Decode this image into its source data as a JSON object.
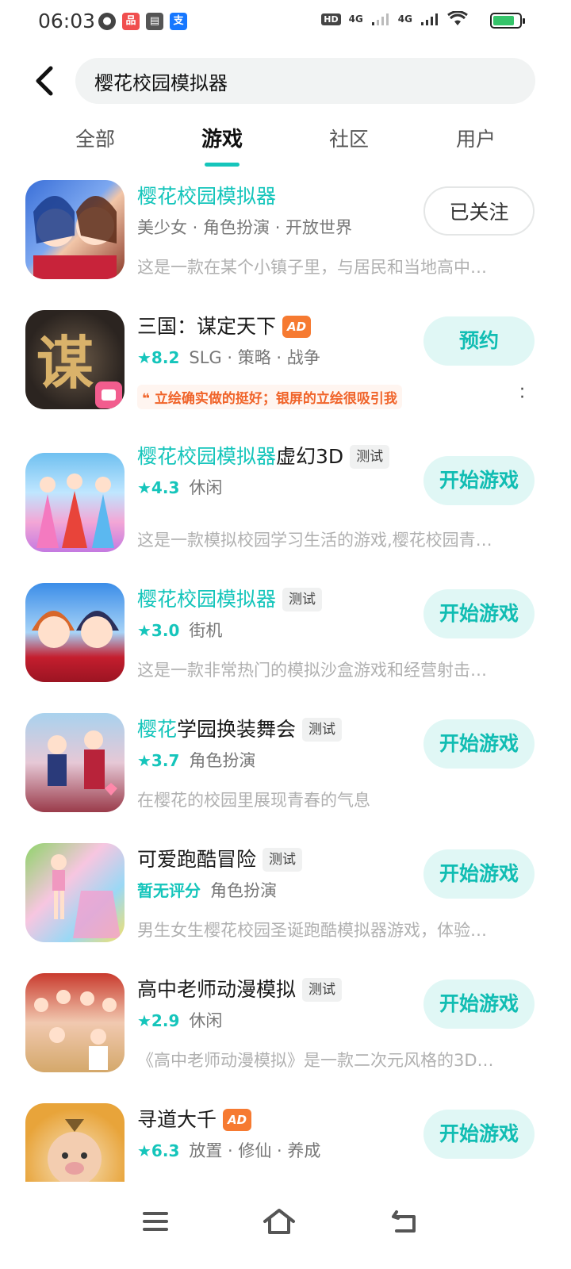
{
  "status_bar": {
    "time": "06:03",
    "network_1": "4G",
    "network_2": "4G",
    "hd": "HD",
    "battery_level": 0.8
  },
  "search": {
    "query": "樱花校园模拟器"
  },
  "tabs": [
    {
      "label": "全部",
      "active": false
    },
    {
      "label": "游戏",
      "active": true
    },
    {
      "label": "社区",
      "active": false
    },
    {
      "label": "用户",
      "active": false
    }
  ],
  "results": [
    {
      "title_hl": "樱花校园模拟器",
      "title_rest": "",
      "tags": "美少女 · 角色扮演 · 开放世界",
      "rating": "",
      "desc": "这是一款在某个小镇子里，与居民和当地高中…",
      "action": "已关注",
      "icon": "game-icon-sakura-school-girls"
    },
    {
      "title_hl": "",
      "title_rest": "三国：谋定天下",
      "ad": "AD",
      "rating": "★8.2",
      "tags": "SLG · 策略 · 战争",
      "quote": "立绘确实做的挺好；银屏的立绘很吸引我",
      "action": "预约",
      "icon": "game-icon-three-kingdoms"
    },
    {
      "title_hl": "樱花校园模拟器",
      "title_rest": "虚幻3D",
      "test": "测试",
      "rating": "★4.3",
      "tags": "休闲",
      "desc": "这是一款模拟校园学习生活的游戏,樱花校园青…",
      "action": "开始游戏",
      "icon": "game-icon-princess-dresses"
    },
    {
      "title_hl": "樱花校园模拟器",
      "title_rest": "",
      "test": "测试",
      "rating": "★3.0",
      "tags": "街机",
      "desc": "这是一款非常热门的模拟沙盒游戏和经营射击…",
      "action": "开始游戏",
      "icon": "game-icon-school-uniform-pair"
    },
    {
      "title_hl": "樱花",
      "title_rest": "学园换装舞会",
      "test": "测试",
      "rating": "★3.7",
      "tags": "角色扮演",
      "desc": "在樱花的校园里展现青春的气息",
      "action": "开始游戏",
      "icon": "game-icon-dress-up-ball"
    },
    {
      "title_hl": "",
      "title_rest": "可爱跑酷冒险",
      "test": "测试",
      "rating_text": "暂无评分",
      "tags": "角色扮演",
      "desc": "男生女生樱花校园圣诞跑酷模拟器游戏，体验…",
      "action": "开始游戏",
      "icon": "game-icon-parkour-runner"
    },
    {
      "title_hl": "",
      "title_rest": "高中老师动漫模拟",
      "test": "测试",
      "rating": "★2.9",
      "tags": "休闲",
      "desc": "《高中老师动漫模拟》是一款二次元风格的3D…",
      "action": "开始游戏",
      "icon": "game-icon-anime-teacher"
    },
    {
      "title_hl": "",
      "title_rest": "寻道大千",
      "ad": "AD",
      "rating": "★6.3",
      "tags": "放置 · 修仙 · 养成",
      "action": "开始游戏",
      "icon": "game-icon-pig-cultivator"
    }
  ],
  "colors": {
    "accent": "#15c5bb",
    "ad_badge": "#f67a31"
  }
}
